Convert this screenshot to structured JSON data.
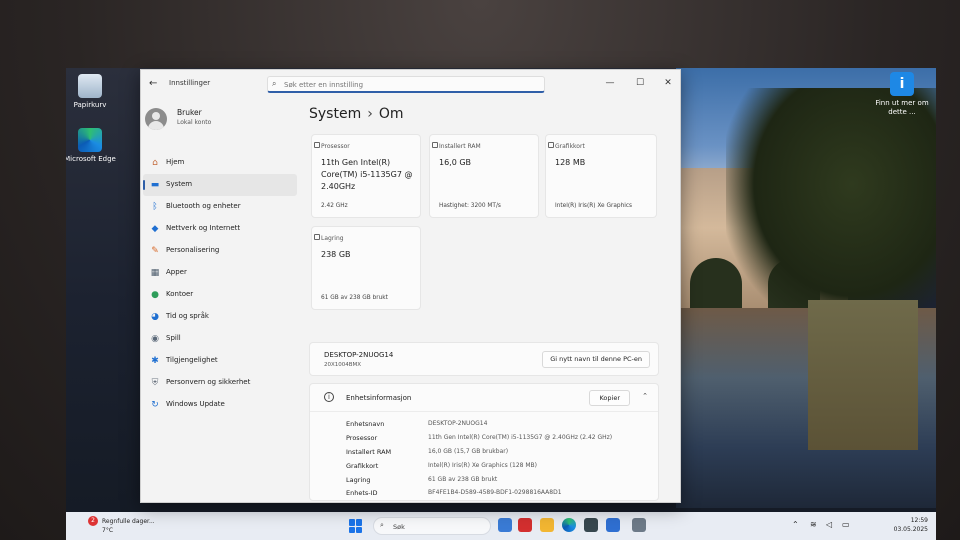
{
  "desktop": {
    "icons": [
      {
        "label": "Papirkurv"
      },
      {
        "label": "Microsoft Edge"
      },
      {
        "label": "Finn ut mer om dette ..."
      }
    ]
  },
  "window": {
    "app_title": "Innstillinger",
    "search_placeholder": "Søk etter en innstilling",
    "back_glyph": "←",
    "min_glyph": "—",
    "max_glyph": "☐",
    "close_glyph": "✕"
  },
  "profile": {
    "name": "Bruker",
    "account_type": "Lokal konto"
  },
  "nav": {
    "items": [
      {
        "label": "Hjem",
        "icon": "home-icon"
      },
      {
        "label": "System",
        "icon": "monitor-icon"
      },
      {
        "label": "Bluetooth og enheter",
        "icon": "bluetooth-icon"
      },
      {
        "label": "Nettverk og Internett",
        "icon": "wifi-icon"
      },
      {
        "label": "Personalisering",
        "icon": "brush-icon"
      },
      {
        "label": "Apper",
        "icon": "apps-icon"
      },
      {
        "label": "Kontoer",
        "icon": "person-icon"
      },
      {
        "label": "Tid og språk",
        "icon": "globe-clock-icon"
      },
      {
        "label": "Spill",
        "icon": "gamepad-icon"
      },
      {
        "label": "Tilgjengelighet",
        "icon": "accessibility-icon"
      },
      {
        "label": "Personvern og sikkerhet",
        "icon": "shield-icon"
      },
      {
        "label": "Windows Update",
        "icon": "update-icon"
      }
    ],
    "active_index": 1
  },
  "breadcrumb": {
    "parent": "System",
    "separator": "›",
    "current": "Om"
  },
  "cards": {
    "processor": {
      "label": "Prosessor",
      "value": "11th Gen Intel(R) Core(TM) i5-1135G7 @ 2.40GHz",
      "foot": "2.42 GHz"
    },
    "ram": {
      "label": "Installert RAM",
      "value": "16,0 GB",
      "foot": "Hastighet: 3200 MT/s"
    },
    "gpu": {
      "label": "Grafikkort",
      "value": "128 MB",
      "foot": "Intel(R) Iris(R) Xe Graphics"
    },
    "storage": {
      "label": "Lagring",
      "value": "238 GB",
      "foot": "61 GB av 238 GB brukt"
    }
  },
  "pc": {
    "name": "DESKTOP-2NUOG14",
    "model": "20X1004BMX",
    "rename_label": "Gi nytt navn til denne PC-en"
  },
  "device_info": {
    "title": "Enhetsinformasjon",
    "copy_label": "Kopier",
    "rows": [
      {
        "key": "Enhetsnavn",
        "value": "DESKTOP-2NUOG14"
      },
      {
        "key": "Prosessor",
        "value": "11th Gen Intel(R) Core(TM) i5-1135G7 @ 2.40GHz (2.42 GHz)"
      },
      {
        "key": "Installert RAM",
        "value": "16,0 GB (15,7 GB brukbar)"
      },
      {
        "key": "Grafikkort",
        "value": "Intel(R) Iris(R) Xe Graphics (128 MB)"
      },
      {
        "key": "Lagring",
        "value": "61 GB av 238 GB brukt"
      },
      {
        "key": "Enhets-ID",
        "value": "BF4FE1B4-D589-4589-BDF1-0298816AA8D1"
      }
    ]
  },
  "taskbar": {
    "weather_badge": "2",
    "weather_text": "Regnfulle dager...",
    "weather_temp": "7°C",
    "search_label": "Søk",
    "time": "12:59",
    "date": "03.05.2025"
  },
  "colors": {
    "accent": "#2f5fa8",
    "window_bg": "#f3f3f3",
    "card_bg": "#fbfbfb"
  }
}
